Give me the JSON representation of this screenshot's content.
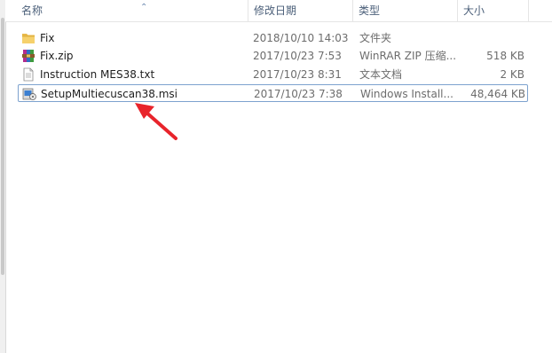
{
  "columns": {
    "name": "名称",
    "modified": "修改日期",
    "type": "类型",
    "size": "大小"
  },
  "files": [
    {
      "name": "Fix",
      "modified": "2018/10/10 14:03",
      "type": "文件夹",
      "size": "",
      "icon": "folder-icon"
    },
    {
      "name": "Fix.zip",
      "modified": "2017/10/23 7:53",
      "type": "WinRAR ZIP 压缩...",
      "size": "518 KB",
      "icon": "winrar-archive-icon"
    },
    {
      "name": "Instruction MES38.txt",
      "modified": "2017/10/23 8:31",
      "type": "文本文档",
      "size": "2 KB",
      "icon": "text-file-icon"
    },
    {
      "name": "SetupMultiecuscan38.msi",
      "modified": "2017/10/23 7:38",
      "type": "Windows Install...",
      "size": "48,464 KB",
      "icon": "msi-installer-icon",
      "selected": true
    }
  ],
  "colors": {
    "header_text": "#4c607a",
    "selection_border": "#7da2ce",
    "annotation_arrow": "#e8242b"
  }
}
